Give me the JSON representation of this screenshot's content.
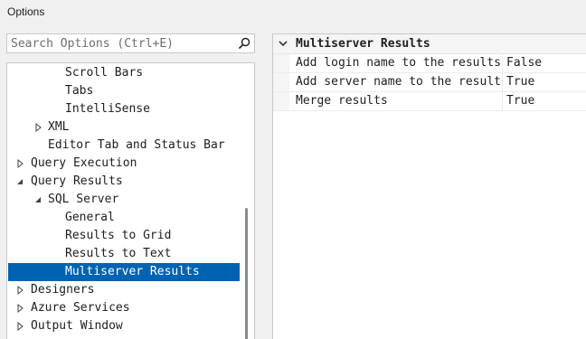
{
  "window": {
    "title": "Options"
  },
  "search": {
    "placeholder": "Search Options (Ctrl+E)",
    "icon": "search-icon"
  },
  "tree": {
    "items": [
      {
        "label": "Scroll Bars"
      },
      {
        "label": "Tabs"
      },
      {
        "label": "IntelliSense"
      },
      {
        "label": "XML",
        "expander": "collapsed"
      },
      {
        "label": "Editor Tab and Status Bar"
      },
      {
        "label": "Query Execution",
        "expander": "collapsed"
      },
      {
        "label": "Query Results",
        "expander": "expanded"
      },
      {
        "label": "SQL Server",
        "expander": "expanded"
      },
      {
        "label": "General"
      },
      {
        "label": "Results to Grid"
      },
      {
        "label": "Results to Text"
      },
      {
        "label": "Multiserver Results",
        "selected": true
      },
      {
        "label": "Designers",
        "expander": "collapsed"
      },
      {
        "label": "Azure Services",
        "expander": "collapsed"
      },
      {
        "label": "Output Window",
        "expander": "collapsed"
      }
    ]
  },
  "property_grid": {
    "category": "Multiserver Results",
    "rows": [
      {
        "name": "Add login name to the results",
        "value": "False"
      },
      {
        "name": "Add server name to the results",
        "value": "True"
      },
      {
        "name": "Merge results",
        "value": "True"
      }
    ]
  },
  "colors": {
    "selection": "#0063b1",
    "selection_text": "#ffffff",
    "background": "#f0f0f0"
  }
}
